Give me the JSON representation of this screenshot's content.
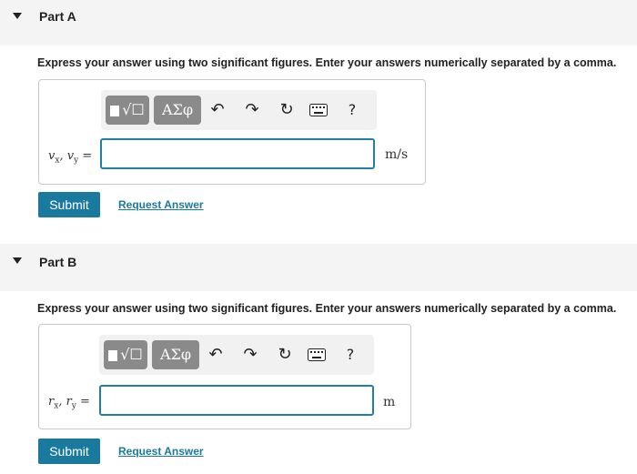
{
  "partA": {
    "title": "Part A",
    "instruction": "Express your answer using two significant figures. Enter your answers numerically separated by a comma.",
    "toolbar": {
      "templates_label": "√☐",
      "symbols_label": "ΑΣφ",
      "help_label": "?"
    },
    "var_label_1": "v",
    "var_sub_1": "x",
    "var_label_2": "v",
    "var_sub_2": "y",
    "equals": "=",
    "answer_value": "",
    "unit": "m/s",
    "submit_label": "Submit",
    "request_answer_label": "Request Answer"
  },
  "partB": {
    "title": "Part B",
    "instruction": "Express your answer using two significant figures. Enter your answers numerically separated by a comma.",
    "toolbar": {
      "templates_label": "√☐",
      "symbols_label": "ΑΣφ",
      "help_label": "?"
    },
    "var_label_1": "r",
    "var_sub_1": "x",
    "var_label_2": "r",
    "var_sub_2": "y",
    "equals": "=",
    "answer_value": "",
    "unit": "m",
    "submit_label": "Submit",
    "request_answer_label": "Request Answer"
  },
  "colors": {
    "accent": "#1a7a9e",
    "input_border": "#1f7fa6",
    "header_bg": "#f4f4f4"
  }
}
